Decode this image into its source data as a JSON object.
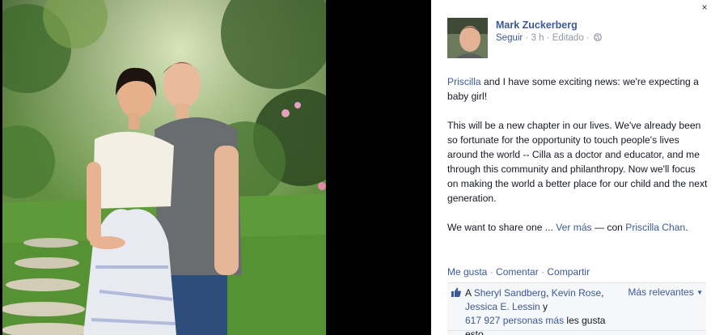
{
  "photo": {
    "alt": ""
  },
  "panel": {
    "close_label": "×",
    "author": "Mark Zuckerberg",
    "meta": {
      "follow": "Seguir",
      "sep1": " · ",
      "time": "3 h",
      "sep2": " · ",
      "edited": "Editado",
      "sep3": " · "
    },
    "post": {
      "mention": "Priscilla",
      "line1_rest": " and I have some exciting news: we're expecting a baby girl!",
      "para2": "This will be a new chapter in our lives. We've already been so fortunate for the opportunity to touch people's lives around the world -- Cilla as a doctor and educator, and me through this community and philanthropy. Now we'll focus on making the world a better place for our child and the next generation.",
      "para3_start": "We want to share one ... ",
      "see_more": "Ver más",
      "with": " — con ",
      "tagged": "Priscilla Chan",
      "tagged_end": "."
    },
    "actions": {
      "like": "Me gusta",
      "sep": " · ",
      "comment": "Comentar",
      "share": "Compartir"
    },
    "likes": {
      "prefix": "A ",
      "person1": "Sheryl Sandberg",
      "comma": ", ",
      "person2": "Kevin Rose",
      "comma2": ",",
      "person3": "Jessica E. Lessin",
      "and": " y",
      "count": "617 927 personas más",
      "suffix": " les gusta esto.",
      "sort": "Más relevantes"
    }
  },
  "colors": {
    "link": "#3b5998",
    "meta": "#9197a3",
    "text": "#141823",
    "panel_bg": "#ffffff",
    "likes_bg": "#f6f7f8"
  },
  "icons": [
    "close-icon",
    "globe-icon",
    "like-thumb-icon",
    "caret-down-icon"
  ]
}
